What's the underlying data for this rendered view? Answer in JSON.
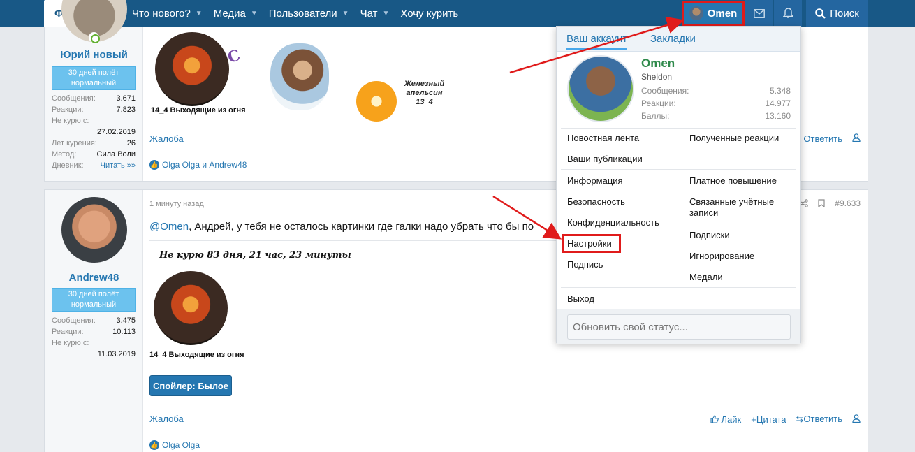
{
  "nav": {
    "forums": "Форумы",
    "whats_new": "Что нового?",
    "media": "Медиа",
    "users": "Пользователи",
    "chat": "Чат",
    "want_smoke": "Хочу курить",
    "account": "Omen",
    "search": "Поиск"
  },
  "post1": {
    "username": "Юрий новый",
    "title": "30 дней полёт нормальный",
    "stats": [
      {
        "label": "Сообщения:",
        "value": "3.671"
      },
      {
        "label": "Реакции:",
        "value": "7.823"
      }
    ],
    "not_smoking_label": "Не курю с:",
    "not_smoking_date": "27.02.2019",
    "stats2": [
      {
        "label": "Лет курения:",
        "value": "26"
      },
      {
        "label": "Метод:",
        "value": "Сила Воли"
      },
      {
        "label": "Дневник:",
        "value": "Читать »»"
      }
    ],
    "report": "Жалоба",
    "reply": "Ответить",
    "likes": "Olga Olga и Andrew48",
    "sig_ring": "14_4 Выходящие из огня",
    "sig_orange": "Железный апельсин 13_4"
  },
  "post2": {
    "username": "Andrew48",
    "title": "30 дней полёт нормальный",
    "stats": [
      {
        "label": "Сообщения:",
        "value": "3.475"
      },
      {
        "label": "Реакции:",
        "value": "10.113"
      }
    ],
    "not_smoking_label": "Не курю с:",
    "not_smoking_date": "11.03.2019",
    "time": "1 минуту назад",
    "post_number": "#9.633",
    "mention": "@Omen",
    "message": ", Андрей, у тебя не осталось картинки где галки надо убрать что бы по",
    "quit_text": "Не курю  83 дня, 21 час, 23 минуты",
    "sig_ring": "14_4 Выходящие из огня",
    "spoiler": "Спойлер: Былое",
    "report": "Жалоба",
    "like": "Лайк",
    "quote": "Цитата",
    "reply": "Ответить",
    "likes": "Olga Olga"
  },
  "menu": {
    "tab_account": "Ваш аккаунт",
    "tab_bookmarks": "Закладки",
    "name": "Omen",
    "subtitle": "Sheldon",
    "stats": [
      {
        "label": "Сообщения:",
        "value": "5.348"
      },
      {
        "label": "Реакции:",
        "value": "14.977"
      },
      {
        "label": "Баллы:",
        "value": "13.160"
      }
    ],
    "news_feed": "Новостная лента",
    "received_reactions": "Полученные реакции",
    "your_posts": "Ваши публикации",
    "info": "Информация",
    "paid_upgrade": "Платное повышение",
    "security": "Безопасность",
    "connected_accounts": "Связанные учётные записи",
    "privacy": "Конфиденциальность",
    "subscriptions": "Подписки",
    "settings": "Настройки",
    "ignoring": "Игнорирование",
    "signature": "Подпись",
    "medals": "Медали",
    "logout": "Выход",
    "status_placeholder": "Обновить свой статус..."
  },
  "colors": {
    "nav_bg": "#185886",
    "link": "#2577b1",
    "highlight": "#e01b1b",
    "user_title_bg": "#6cc2ee",
    "online_name": "#2f8a4b"
  }
}
